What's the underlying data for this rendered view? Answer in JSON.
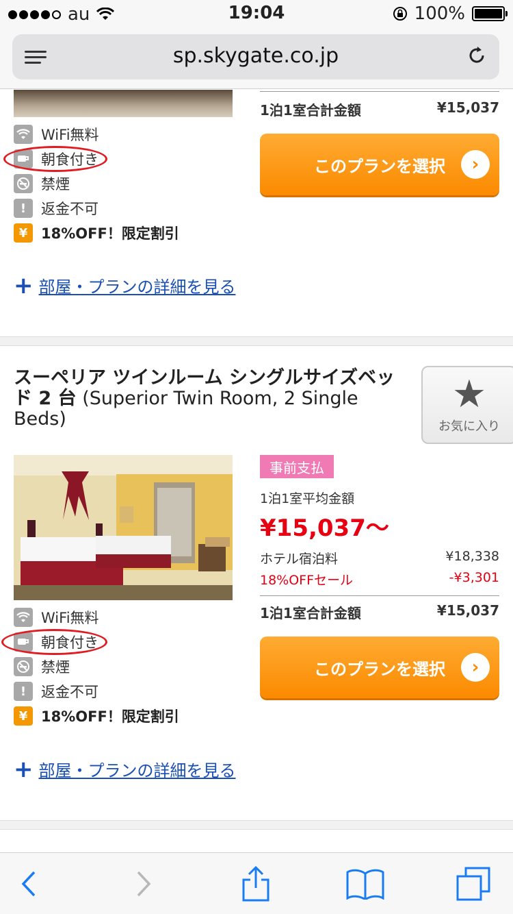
{
  "status_bar": {
    "carrier": "au",
    "time": "19:04",
    "battery": "100%"
  },
  "browser": {
    "url": "sp.skygate.co.jp"
  },
  "card1": {
    "total_label": "1泊1室合計金額",
    "total_value": "¥15,037",
    "select_label": "このプランを選択",
    "amenities": [
      "WiFi無料",
      "朝食付き",
      "禁煙",
      "返金不可",
      "18%OFF！限定割引"
    ],
    "amenity_icons": [
      "wifi-icon",
      "breakfast-icon",
      "no-smoking-icon",
      "exclamation-icon",
      "yen-icon"
    ],
    "detail_link": "部屋・プランの詳細を見る"
  },
  "card2": {
    "title_jp": "スーペリア ツインルーム シングルサイズベッド 2 台",
    "title_en": "(Superior Twin Room, 2 Single Beds)",
    "favorite_label": "お気に入り",
    "badge": "事前支払",
    "avg_label": "1泊1室平均金額",
    "avg_price": "¥15,037〜",
    "hotel_rate_label": "ホテル宿泊料",
    "hotel_rate_value": "¥18,338",
    "sale_label": "18%OFFセール",
    "sale_value": "-¥3,301",
    "total_label": "1泊1室合計金額",
    "total_value": "¥15,037",
    "select_label": "このプランを選択",
    "amenities": [
      "WiFi無料",
      "朝食付き",
      "禁煙",
      "返金不可",
      "18%OFF！限定割引"
    ],
    "amenity_icons": [
      "wifi-icon",
      "breakfast-icon",
      "no-smoking-icon",
      "exclamation-icon",
      "yen-icon"
    ],
    "detail_link": "部屋・プランの詳細を見る"
  },
  "colors": {
    "accent_orange": "#fb8a00",
    "price_red": "#e60012",
    "badge_pink": "#f07ab4",
    "link_blue": "#1a4fb3",
    "highlight_circle": "#e01b22"
  }
}
